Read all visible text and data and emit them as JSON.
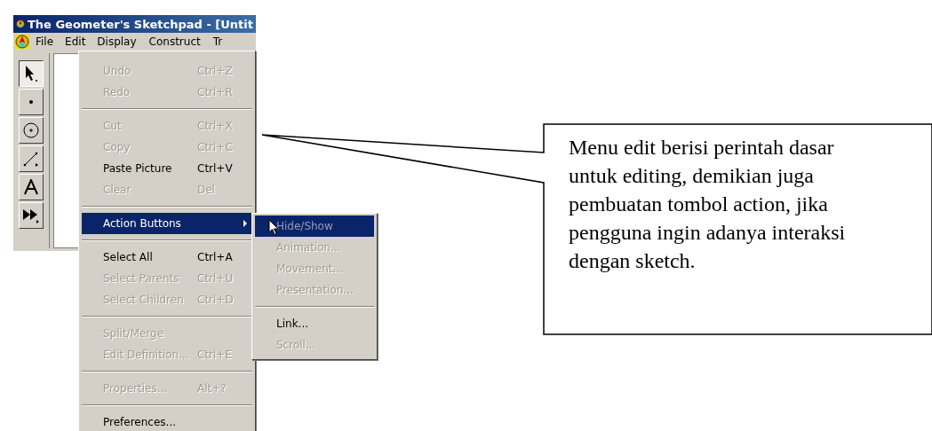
{
  "window": {
    "title": "The Geometer's Sketchpad - [Untit"
  },
  "menubar": [
    {
      "label": "File",
      "selected": false
    },
    {
      "label": "Edit",
      "selected": true
    },
    {
      "label": "Display",
      "selected": false
    },
    {
      "label": "Construct",
      "selected": false
    },
    {
      "label": "Tr",
      "selected": false
    }
  ],
  "toolbar": [
    {
      "kind": "arrow",
      "selected": true
    },
    {
      "kind": "point",
      "selected": false
    },
    {
      "kind": "compass",
      "selected": false
    },
    {
      "kind": "line",
      "selected": false
    },
    {
      "kind": "text",
      "selected": false
    },
    {
      "kind": "custom",
      "selected": false
    }
  ],
  "edit_menu": [
    {
      "kind": "item",
      "label": "Undo",
      "shortcut": "Ctrl+Z",
      "disabled": true,
      "selected": false
    },
    {
      "kind": "item",
      "label": "Redo",
      "shortcut": "Ctrl+R",
      "disabled": true,
      "selected": false
    },
    {
      "kind": "separator"
    },
    {
      "kind": "item",
      "label": "Cut",
      "shortcut": "Ctrl+X",
      "disabled": true,
      "selected": false
    },
    {
      "kind": "item",
      "label": "Copy",
      "shortcut": "Ctrl+C",
      "disabled": true,
      "selected": false
    },
    {
      "kind": "item",
      "label": "Paste Picture",
      "shortcut": "Ctrl+V",
      "disabled": false,
      "selected": false
    },
    {
      "kind": "item",
      "label": "Clear",
      "shortcut": "Del",
      "disabled": true,
      "selected": false
    },
    {
      "kind": "separator"
    },
    {
      "kind": "submenu",
      "label": "Action Buttons",
      "disabled": false,
      "selected": true
    },
    {
      "kind": "separator"
    },
    {
      "kind": "item",
      "label": "Select All",
      "shortcut": "Ctrl+A",
      "disabled": false,
      "selected": false
    },
    {
      "kind": "item",
      "label": "Select Parents",
      "shortcut": "Ctrl+U",
      "disabled": true,
      "selected": false
    },
    {
      "kind": "item",
      "label": "Select Children",
      "shortcut": "Ctrl+D",
      "disabled": true,
      "selected": false
    },
    {
      "kind": "separator"
    },
    {
      "kind": "item",
      "label": "Split/Merge",
      "disabled": true,
      "selected": false
    },
    {
      "kind": "item",
      "label": "Edit Definition...",
      "shortcut": "Ctrl+E",
      "disabled": true,
      "selected": false
    },
    {
      "kind": "separator"
    },
    {
      "kind": "item",
      "label": "Properties...",
      "shortcut": "Alt+?",
      "disabled": true,
      "selected": false
    },
    {
      "kind": "separator"
    },
    {
      "kind": "item",
      "label": "Preferences...",
      "disabled": false,
      "selected": false
    }
  ],
  "action_buttons_menu": [
    {
      "kind": "item",
      "label": "Hide/Show",
      "disabled": true,
      "selected": true
    },
    {
      "kind": "item",
      "label": "Animation...",
      "disabled": true,
      "selected": false
    },
    {
      "kind": "item",
      "label": "Movement...",
      "disabled": true,
      "selected": false
    },
    {
      "kind": "item",
      "label": "Presentation...",
      "disabled": true,
      "selected": false
    },
    {
      "kind": "separator"
    },
    {
      "kind": "item",
      "label": "Link...",
      "disabled": false,
      "selected": false
    },
    {
      "kind": "item",
      "label": "Scroll...",
      "disabled": true,
      "selected": false
    }
  ],
  "callout": {
    "text": "Menu edit berisi perintah dasar untuk editing, demikian juga pembuatan tombol action, jika pengguna ingin adanya interaksi dengan sketch."
  }
}
